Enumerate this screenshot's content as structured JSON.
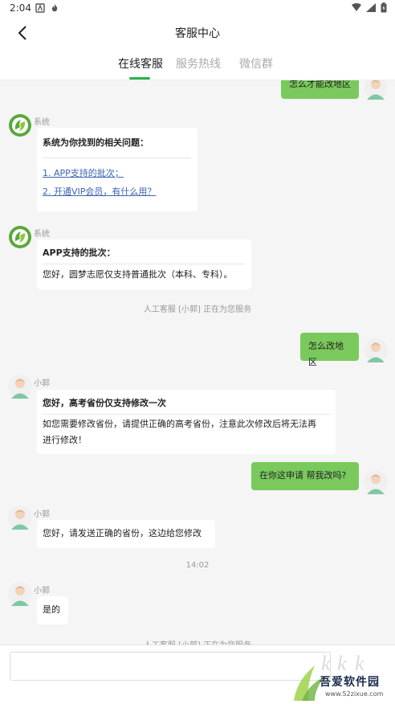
{
  "status": {
    "time": "2:04"
  },
  "header": {
    "title": "客服中心"
  },
  "tabs": [
    {
      "label": "在线客服"
    },
    {
      "label": "服务热线"
    },
    {
      "label": "微信群"
    }
  ],
  "chat": {
    "m0": {
      "text": "怎么才能改地区"
    },
    "m1": {
      "sender": "系统",
      "heading": "系统为你找到的相关问题：",
      "links": [
        "1. APP支持的批次；",
        "2. 开通VIP会员，有什么用？"
      ]
    },
    "m2": {
      "sender": "系统",
      "heading": "APP支持的批次：",
      "body": "您好，圆梦志愿仅支持普通批次（本科、专科）。"
    },
    "s1": "人工客服 [小郭] 正在为您服务",
    "m3": {
      "text": "怎么改地区"
    },
    "m4": {
      "sender": "小郭",
      "heading": "您好，高考省份仅支持修改一次",
      "body_line1": "如您需要修改省份，请提供正确的高考省份，注意此次修改后将无法再",
      "body_line2": "进行修改！"
    },
    "m5": {
      "text": "在你这申请 帮我改吗?"
    },
    "m6": {
      "sender": "小郭",
      "text": "您好，请发送正确的省份，这边给您修改"
    },
    "time1": "14:02",
    "m7": {
      "sender": "小郭",
      "text": "是的"
    },
    "s2": "人工客服 [小郭] 正在为您服务"
  },
  "input": {
    "placeholder": ""
  },
  "watermark": {
    "text": "吾爱软件园",
    "url": "www.52zixue.com"
  },
  "colors": {
    "accent": "#2bb24c",
    "my_bubble": "#7ac95d",
    "link": "#3d64b0"
  }
}
